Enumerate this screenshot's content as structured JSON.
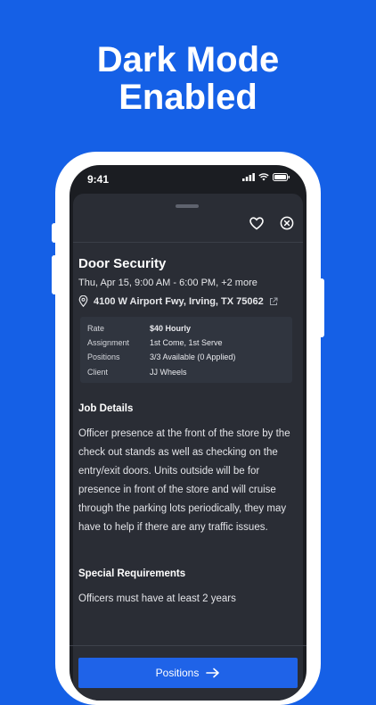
{
  "headline": {
    "line1": "Dark Mode",
    "line2": "Enabled"
  },
  "status_bar": {
    "time": "9:41"
  },
  "job": {
    "title": "Door Security",
    "datetime": "Thu, Apr 15, 9:00 AM - 6:00 PM, +2 more",
    "address": "4100 W Airport Fwy, Irving, TX 75062"
  },
  "info": [
    {
      "label": "Rate",
      "value": "$40 Hourly"
    },
    {
      "label": "Assignment",
      "value": "1st Come, 1st Serve"
    },
    {
      "label": "Positions",
      "value": "3/3 Available (0 Applied)"
    },
    {
      "label": "Client",
      "value": "JJ Wheels"
    }
  ],
  "job_details": {
    "heading": "Job Details",
    "text": "Officer presence at the front of the store by the check out stands as well as checking on the entry/exit doors. Units outside will be for presence in front of the store and will cruise through the parking lots periodically, they may have to help if there are any traffic issues."
  },
  "special_requirements": {
    "heading": "Special Requirements",
    "text": "Officers must have at least 2 years"
  },
  "cta": {
    "label": "Positions"
  },
  "icons": {
    "favorite": "heart-icon",
    "close": "close-circle-icon",
    "location": "location-pin-icon",
    "external": "external-link-icon",
    "arrow": "arrow-right-icon"
  }
}
